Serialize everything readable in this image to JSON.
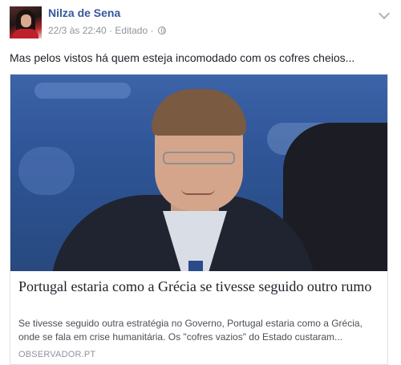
{
  "post": {
    "author": "Nilza de Sena",
    "timestamp": "22/3 às 22:40",
    "separator": "·",
    "edited": "Editado",
    "separator2": "·",
    "message": "Mas pelos vistos há quem esteja incomodado com os cofres cheios..."
  },
  "link": {
    "title": "Portugal estaria como a Grécia se tivesse seguido outro rumo",
    "description": "Se tivesse seguido outra estratégia no Governo, Portugal estaria como a Grécia, onde se fala em crise humanitária. Os \"cofres vazios\" do Estado custaram...",
    "source": "OBSERVADOR.PT"
  },
  "icons": {
    "privacy": "globe-icon",
    "menu": "chevron-down-icon"
  },
  "colors": {
    "author": "#365899",
    "meta": "#90949c",
    "text": "#1d2129",
    "border": "#dddfe2"
  }
}
